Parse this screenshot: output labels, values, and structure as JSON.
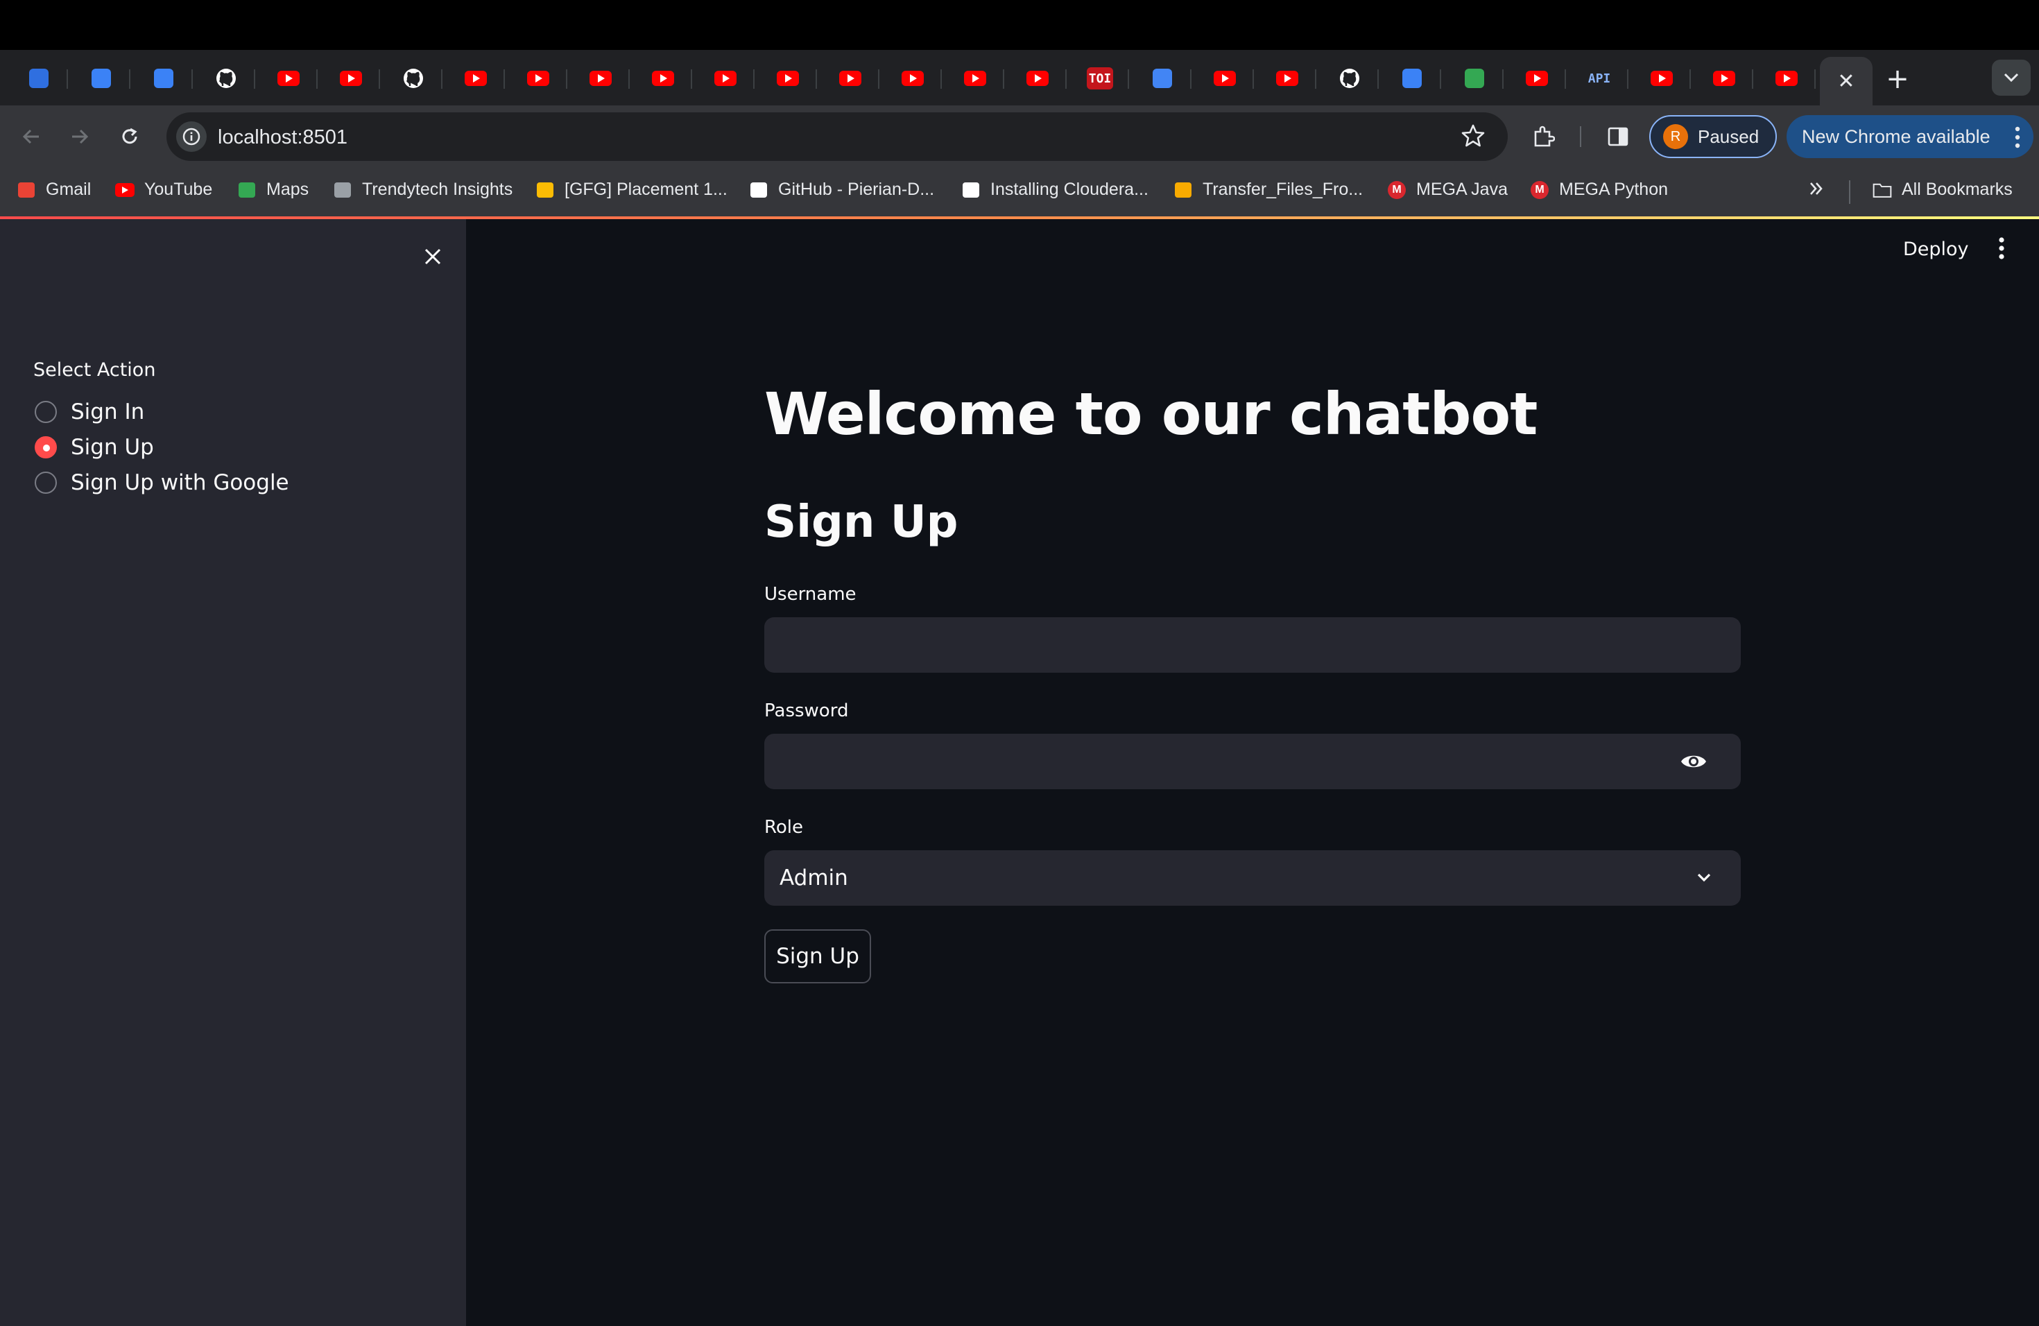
{
  "browser": {
    "tabs": [
      {
        "icon": "azure-devops-icon",
        "color": "#2f6fe0"
      },
      {
        "icon": "vscode-icon",
        "color": "#3b82f6"
      },
      {
        "icon": "azure-icon",
        "color": "#3b82f6"
      },
      {
        "icon": "github-icon",
        "color": "#ffffff"
      },
      {
        "icon": "youtube-icon"
      },
      {
        "icon": "youtube-icon"
      },
      {
        "icon": "github-icon",
        "color": "#ffffff"
      },
      {
        "icon": "youtube-icon"
      },
      {
        "icon": "youtube-icon"
      },
      {
        "icon": "youtube-icon"
      },
      {
        "icon": "youtube-icon"
      },
      {
        "icon": "youtube-icon"
      },
      {
        "icon": "youtube-icon"
      },
      {
        "icon": "youtube-icon"
      },
      {
        "icon": "youtube-icon"
      },
      {
        "icon": "youtube-icon"
      },
      {
        "icon": "youtube-icon"
      },
      {
        "icon": "toi-icon",
        "text": "TOI"
      },
      {
        "icon": "google-docs-icon",
        "color": "#4285f4"
      },
      {
        "icon": "youtube-icon"
      },
      {
        "icon": "youtube-icon"
      },
      {
        "icon": "github-icon",
        "color": "#ffffff"
      },
      {
        "icon": "pen-tool-icon",
        "color": "#3b82f6"
      },
      {
        "icon": "gemini-icon",
        "color": "#34a853"
      },
      {
        "icon": "youtube-icon"
      },
      {
        "icon": "api-icon",
        "text": "API"
      },
      {
        "icon": "youtube-icon"
      },
      {
        "icon": "youtube-icon"
      },
      {
        "icon": "youtube-icon"
      }
    ],
    "url": "localhost:8501",
    "profile_initial": "R",
    "profile_status": "Paused",
    "update_label": "New Chrome available",
    "bookmarks": [
      {
        "label": "Gmail",
        "icon": "gmail-icon"
      },
      {
        "label": "YouTube",
        "icon": "youtube-icon"
      },
      {
        "label": "Maps",
        "icon": "maps-icon"
      },
      {
        "label": "Trendytech Insights",
        "icon": "trendytech-icon"
      },
      {
        "label": "[GFG] Placement 1...",
        "icon": "google-drive-icon"
      },
      {
        "label": "GitHub - Pierian-D...",
        "icon": "github-icon"
      },
      {
        "label": "Installing Cloudera...",
        "icon": "medium-icon"
      },
      {
        "label": "Transfer_Files_Fro...",
        "icon": "colab-icon"
      },
      {
        "label": "MEGA Java",
        "icon": "mega-icon"
      },
      {
        "label": "MEGA Python",
        "icon": "mega-icon"
      }
    ],
    "all_bookmarks_label": "All Bookmarks"
  },
  "app": {
    "header": {
      "deploy_label": "Deploy"
    },
    "sidebar": {
      "select_label": "Select Action",
      "options": [
        {
          "label": "Sign In",
          "selected": false
        },
        {
          "label": "Sign Up",
          "selected": true
        },
        {
          "label": "Sign Up with Google",
          "selected": false
        }
      ]
    },
    "main": {
      "title": "Welcome to our chatbot",
      "subtitle": "Sign Up",
      "username_label": "Username",
      "username_value": "",
      "password_label": "Password",
      "password_value": "",
      "role_label": "Role",
      "role_value": "Admin",
      "submit_label": "Sign Up"
    },
    "colors": {
      "accent": "#ff4b4b",
      "sidebar_bg": "#262730",
      "main_bg": "#0e1117"
    }
  }
}
